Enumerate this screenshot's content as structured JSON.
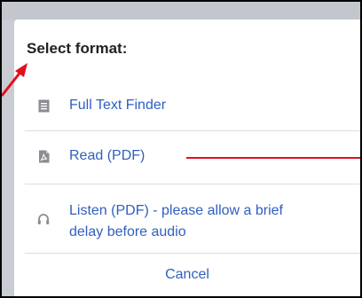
{
  "dialog": {
    "title": "Select format:",
    "options": [
      {
        "label": "Full Text Finder",
        "icon": "document-lines-icon"
      },
      {
        "label": "Read (PDF)",
        "icon": "pdf-icon"
      },
      {
        "label_lines": [
          "Listen (PDF) - please allow a brief",
          "delay before audio"
        ],
        "icon": "headphones-icon"
      }
    ],
    "cancel_label": "Cancel"
  },
  "colors": {
    "link": "#2f5fbf",
    "title": "#222222",
    "icon": "#8a8d92",
    "annotation": "#e01020"
  }
}
